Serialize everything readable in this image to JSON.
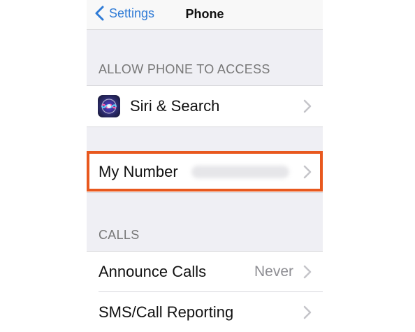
{
  "nav": {
    "back_label": "Settings",
    "title": "Phone"
  },
  "sections": {
    "allow_access_header": "ALLOW PHONE TO ACCESS",
    "calls_header": "CALLS"
  },
  "rows": {
    "siri_search": {
      "label": "Siri & Search",
      "icon": "siri-icon"
    },
    "my_number": {
      "label": "My Number"
    },
    "announce_calls": {
      "label": "Announce Calls",
      "value": "Never"
    },
    "sms_call_reporting": {
      "label": "SMS/Call Reporting"
    }
  },
  "colors": {
    "accent": "#2f7bd6",
    "highlight": "#e8581e",
    "background": "#efeff4"
  }
}
